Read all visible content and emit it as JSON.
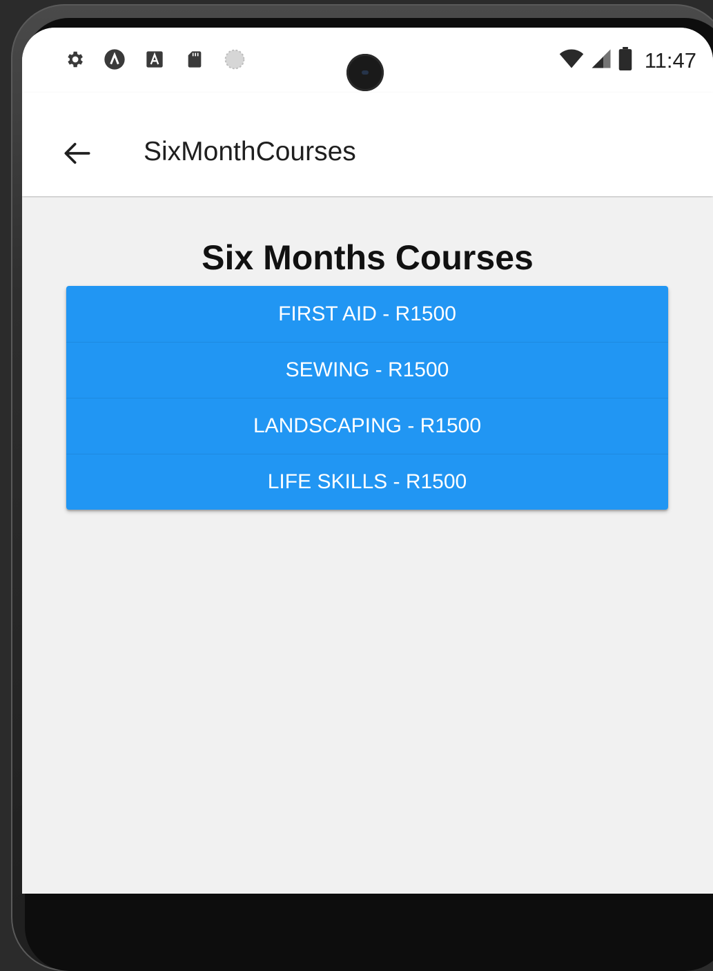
{
  "status_bar": {
    "time": "11:47",
    "left_icons": [
      "settings-gear-icon",
      "android-studio-icon",
      "text-a-icon",
      "sd-card-icon",
      "loading-circle-icon"
    ],
    "right_icons": [
      "wifi-icon",
      "cell-signal-icon",
      "battery-icon"
    ]
  },
  "app_bar": {
    "back_icon": "arrow-left-icon",
    "title": "SixMonthCourses"
  },
  "main": {
    "heading": "Six Months Courses",
    "courses": [
      {
        "label": "FIRST AID - R1500"
      },
      {
        "label": "SEWING - R1500"
      },
      {
        "label": "LANDSCAPING - R1500"
      },
      {
        "label": "LIFE SKILLS - R1500"
      }
    ]
  },
  "colors": {
    "button": "#2196f3",
    "background": "#f1f1f1",
    "app_bar": "#ffffff"
  }
}
